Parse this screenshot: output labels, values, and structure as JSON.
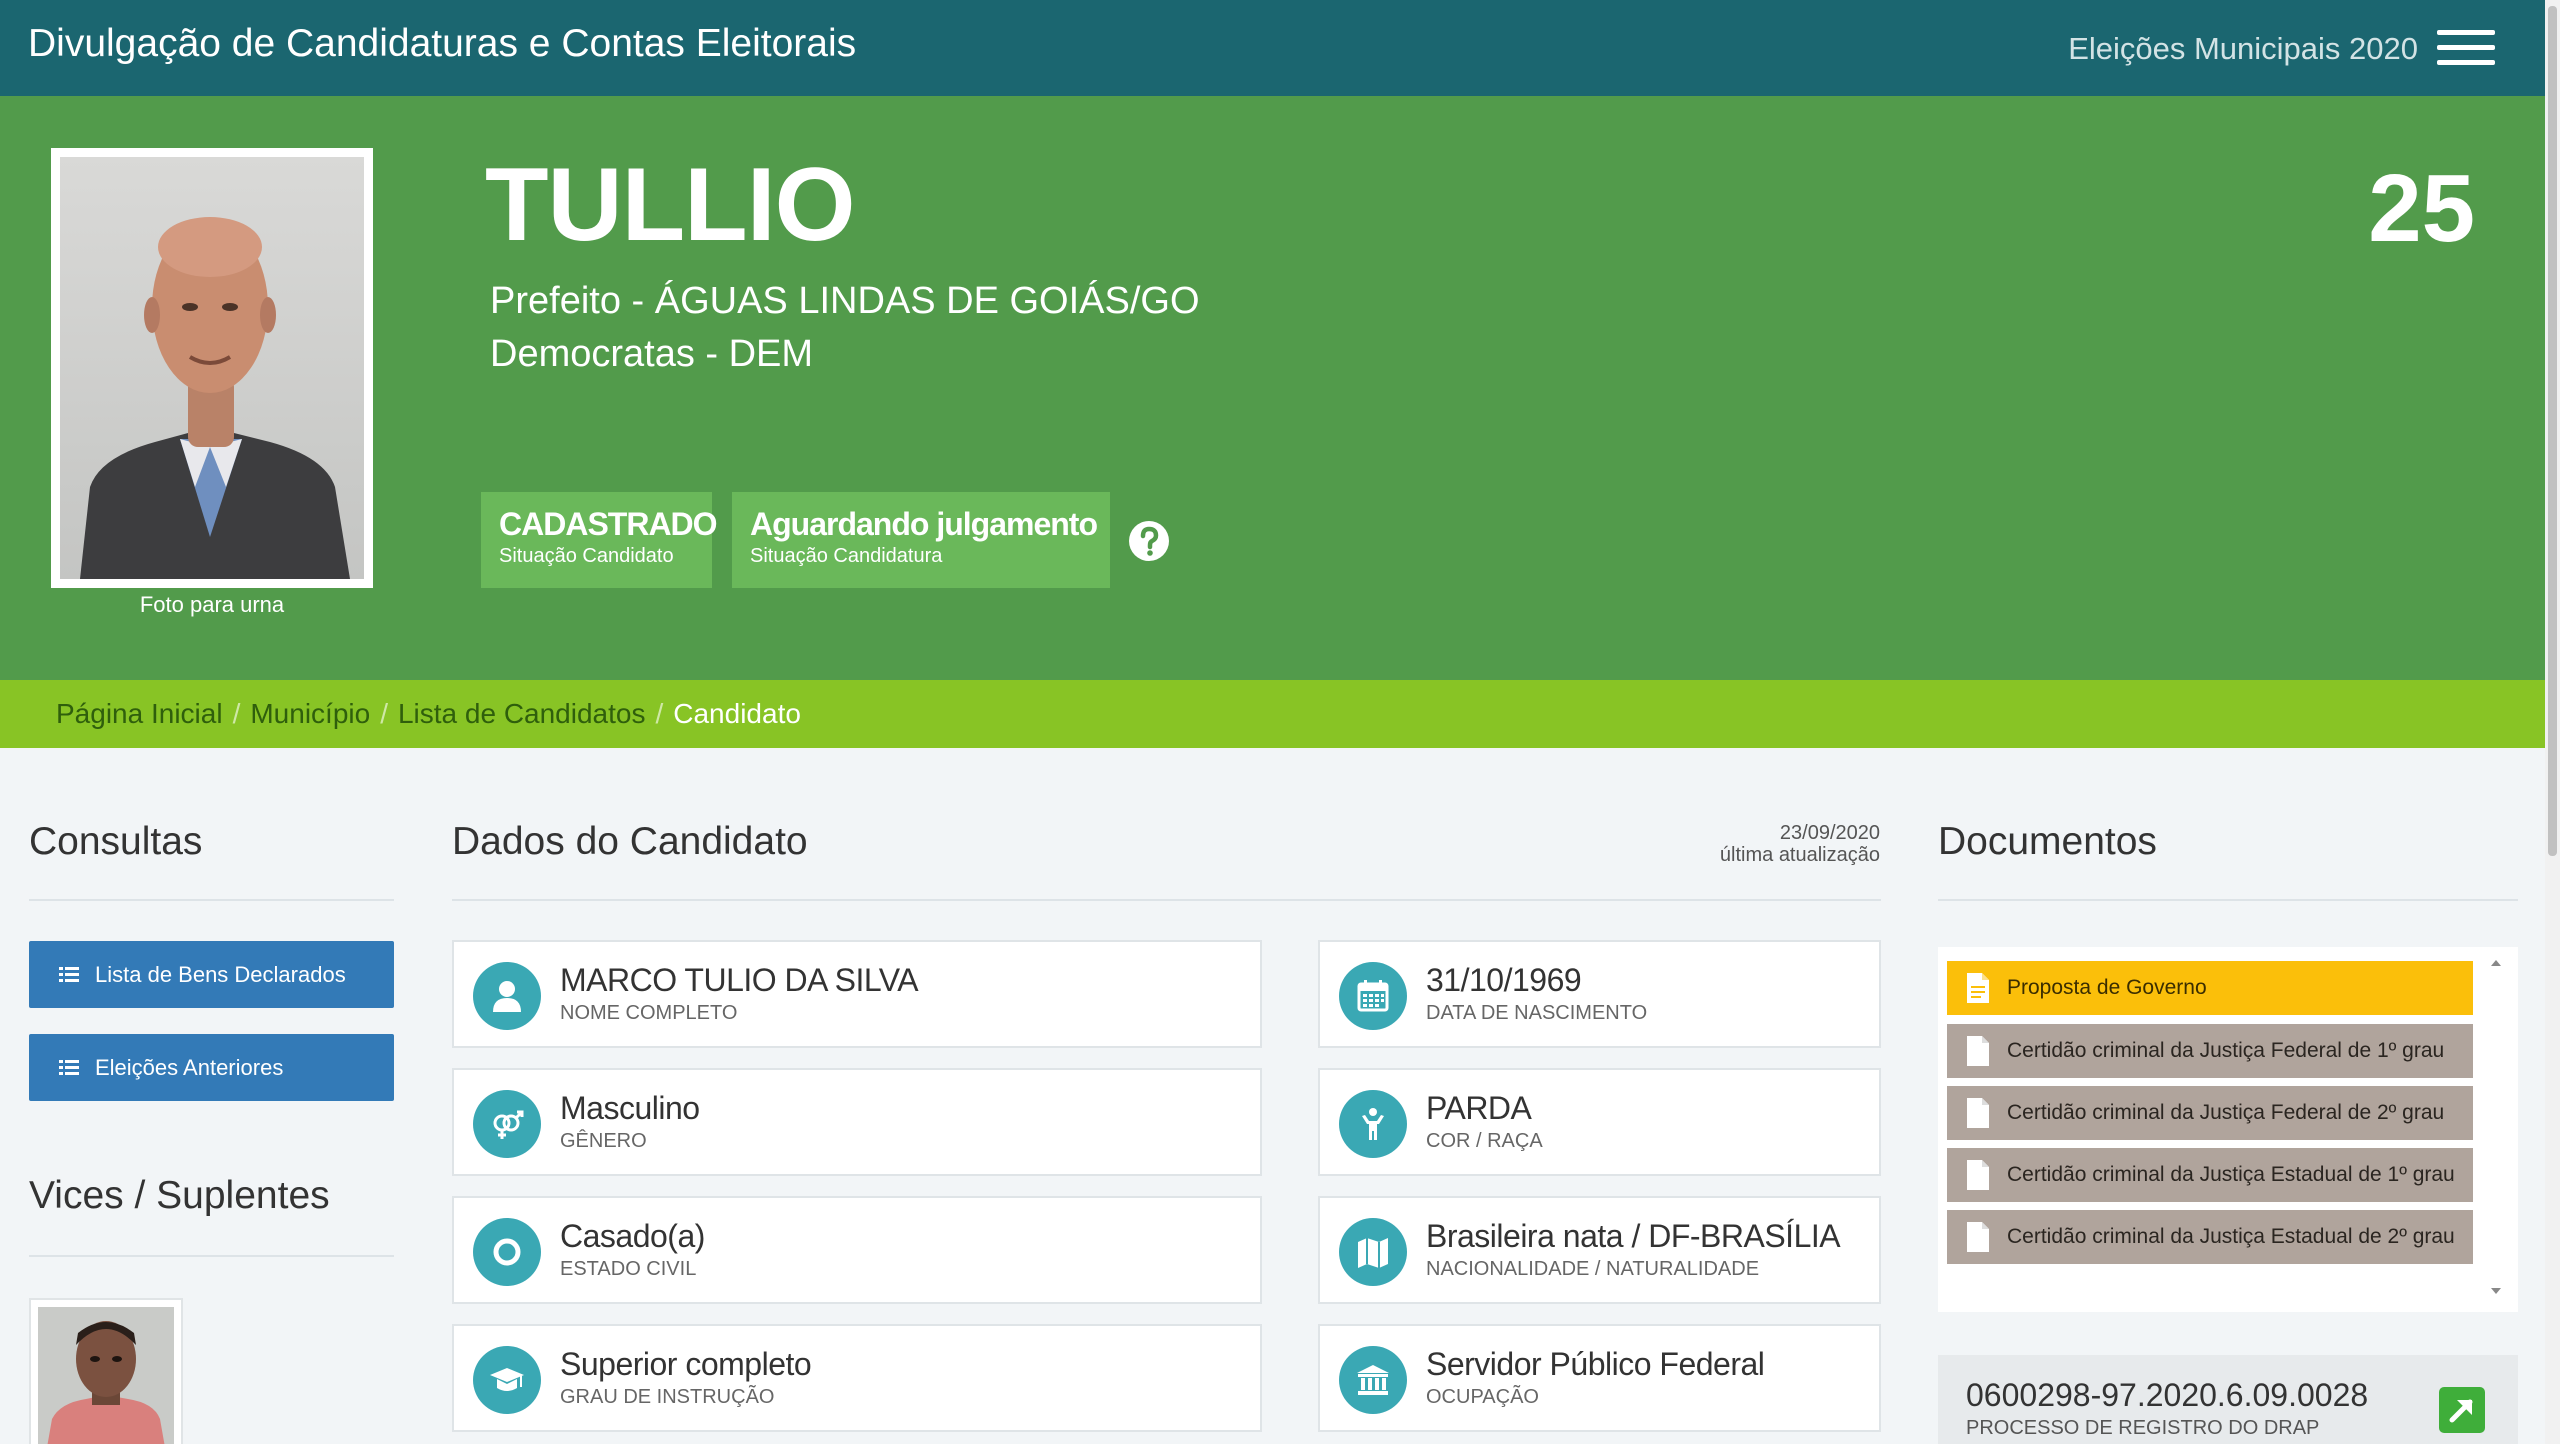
{
  "header": {
    "title": "Divulgação de Candidaturas e Contas Eleitorais",
    "election": "Eleições Municipais 2020"
  },
  "candidate": {
    "photo_caption": "Foto para urna",
    "name": "TULLIO",
    "role": "Prefeito - ÁGUAS LINDAS DE GOIÁS/GO",
    "party": "Democratas - DEM",
    "number": "25",
    "status_candidate": {
      "value": "CADASTRADO",
      "label": "Situação Candidato"
    },
    "status_candidacy": {
      "value": "Aguardando julgamento",
      "label": "Situação Candidatura"
    }
  },
  "breadcrumb": {
    "items": [
      "Página Inicial",
      "Município",
      "Lista de Candidatos"
    ],
    "current": "Candidato",
    "separator": "/"
  },
  "consultas": {
    "title": "Consultas",
    "buttons": [
      "Lista de Bens Declarados",
      "Eleições Anteriores"
    ]
  },
  "vices": {
    "title": "Vices / Suplentes"
  },
  "dados": {
    "title": "Dados do Candidato",
    "updated_date": "23/09/2020",
    "updated_label": "última atualização",
    "fields": [
      {
        "value": "MARCO TULIO DA SILVA",
        "label": "Nome completo",
        "icon": "user-icon"
      },
      {
        "value": "31/10/1969",
        "label": "Data de nascimento",
        "icon": "calendar-icon"
      },
      {
        "value": "Masculino",
        "label": "Gênero",
        "icon": "gender-icon"
      },
      {
        "value": "PARDA",
        "label": "Cor / Raça",
        "icon": "person-icon"
      },
      {
        "value": "Casado(a)",
        "label": "Estado civil",
        "icon": "ring-icon"
      },
      {
        "value": "Brasileira nata / DF-BRASÍLIA",
        "label": "Nacionalidade / Naturalidade",
        "icon": "map-icon"
      },
      {
        "value": "Superior completo",
        "label": "Grau de instrução",
        "icon": "graduation-cap-icon"
      },
      {
        "value": "Servidor Público Federal",
        "label": "Ocupação",
        "icon": "institution-icon"
      }
    ]
  },
  "documentos": {
    "title": "Documentos",
    "items": [
      "Proposta de Governo",
      "Certidão criminal da Justiça Federal de 1º grau",
      "Certidão criminal da Justiça Federal de 2º grau",
      "Certidão criminal da Justiça Estadual de 1º grau",
      "Certidão criminal da Justiça Estadual de 2º grau"
    ],
    "process_number": "0600298-97.2020.6.09.0028",
    "process_label": "PROCESSO DE REGISTRO DO DRAP"
  },
  "colors": {
    "topbar": "#1b6670",
    "hero": "#529b4b",
    "status_box": "#6ab85a",
    "breadcrumb": "#88c425",
    "button": "#337ab7",
    "icon_circle": "#3aa8b4",
    "doc_highlight": "#fbbf0a",
    "doc_default": "#b0a49c"
  }
}
